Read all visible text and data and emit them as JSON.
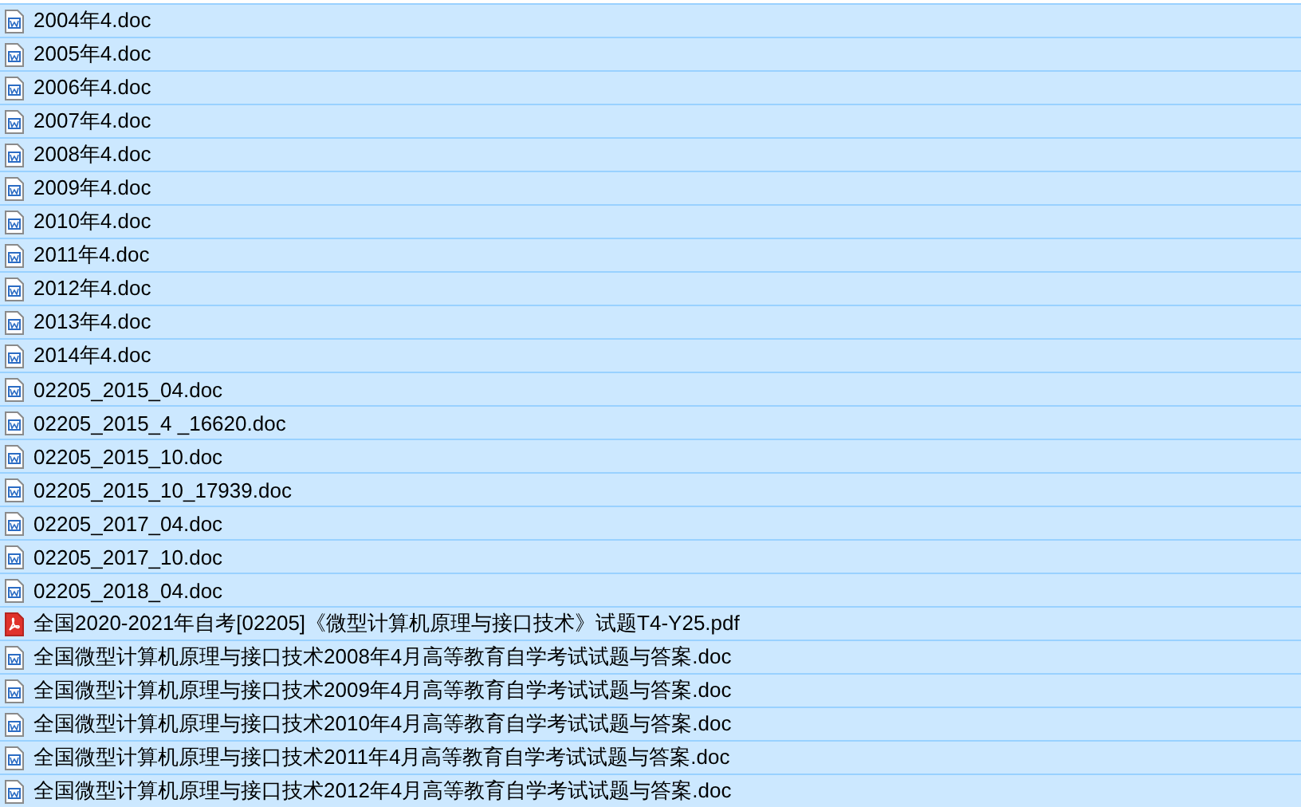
{
  "files": [
    {
      "name": "2004年4.doc",
      "kind": "doc",
      "selected": true
    },
    {
      "name": "2005年4.doc",
      "kind": "doc",
      "selected": true
    },
    {
      "name": "2006年4.doc",
      "kind": "doc",
      "selected": true
    },
    {
      "name": "2007年4.doc",
      "kind": "doc",
      "selected": true
    },
    {
      "name": "2008年4.doc",
      "kind": "doc",
      "selected": true
    },
    {
      "name": "2009年4.doc",
      "kind": "doc",
      "selected": true
    },
    {
      "name": "2010年4.doc",
      "kind": "doc",
      "selected": true
    },
    {
      "name": "2011年4.doc",
      "kind": "doc",
      "selected": true
    },
    {
      "name": "2012年4.doc",
      "kind": "doc",
      "selected": true
    },
    {
      "name": "2013年4.doc",
      "kind": "doc",
      "selected": true
    },
    {
      "name": "2014年4.doc",
      "kind": "doc",
      "selected": true
    },
    {
      "name": "02205_2015_04.doc",
      "kind": "doc",
      "selected": true
    },
    {
      "name": "02205_2015_4 _16620.doc",
      "kind": "doc",
      "selected": true
    },
    {
      "name": "02205_2015_10.doc",
      "kind": "doc",
      "selected": true
    },
    {
      "name": "02205_2015_10_17939.doc",
      "kind": "doc",
      "selected": true
    },
    {
      "name": "02205_2017_04.doc",
      "kind": "doc",
      "selected": true
    },
    {
      "name": "02205_2017_10.doc",
      "kind": "doc",
      "selected": true
    },
    {
      "name": "02205_2018_04.doc",
      "kind": "doc",
      "selected": true
    },
    {
      "name": "全国2020-2021年自考[02205]《微型计算机原理与接口技术》试题T4-Y25.pdf",
      "kind": "pdf",
      "selected": true
    },
    {
      "name": "全国微型计算机原理与接口技术2008年4月高等教育自学考试试题与答案.doc",
      "kind": "doc",
      "selected": true
    },
    {
      "name": "全国微型计算机原理与接口技术2009年4月高等教育自学考试试题与答案.doc",
      "kind": "doc",
      "selected": true
    },
    {
      "name": "全国微型计算机原理与接口技术2010年4月高等教育自学考试试题与答案.doc",
      "kind": "doc",
      "selected": true
    },
    {
      "name": "全国微型计算机原理与接口技术2011年4月高等教育自学考试试题与答案.doc",
      "kind": "doc",
      "selected": true
    },
    {
      "name": "全国微型计算机原理与接口技术2012年4月高等教育自学考试试题与答案.doc",
      "kind": "doc",
      "selected": true
    }
  ]
}
